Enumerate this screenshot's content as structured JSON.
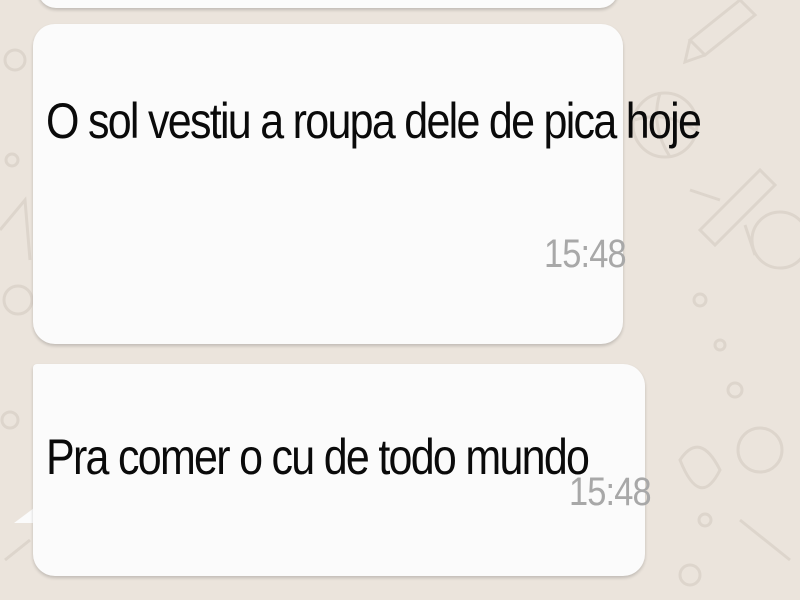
{
  "colors": {
    "wallpaper": "#ebe4dc",
    "bubble": "#fbfbfb",
    "message_text": "#0a0a0a",
    "timestamp": "#a8a8a8"
  },
  "wallpaper": {
    "icons": [
      "basketball-icon",
      "airplane-icon",
      "pencil-icon",
      "circle-icon"
    ]
  },
  "messages": [
    {
      "text": "O sol vestiu a roupa dele de pica hoje",
      "time": "15:48"
    },
    {
      "text": "Pra comer o cu de todo mundo",
      "time": "15:48"
    }
  ]
}
